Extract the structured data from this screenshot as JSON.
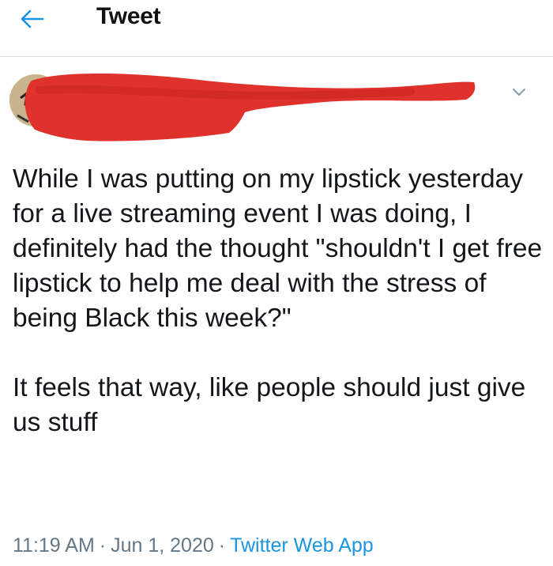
{
  "header": {
    "back_icon": "arrow-left-icon",
    "title": "Tweet"
  },
  "author": {
    "avatar_icon": "avatar",
    "name_redacted": true,
    "menu_icon": "chevron-down-icon"
  },
  "tweet": {
    "paragraphs": [
      "While I was putting on my lipstick yesterday for a live streaming event I was doing, I definitely had the thought \"shouldn't I get free lipstick to help me deal with the stress of being Black this week?\"",
      "It feels that way, like people should just give us stuff"
    ]
  },
  "meta": {
    "time": "11:19 AM",
    "separator": "·",
    "date": "Jun 1, 2020",
    "source": "Twitter Web App"
  },
  "colors": {
    "accent": "#1b95e0",
    "redaction": "#e0322c",
    "text": "#14171a",
    "muted": "#657786",
    "divider": "#d7dde3"
  }
}
